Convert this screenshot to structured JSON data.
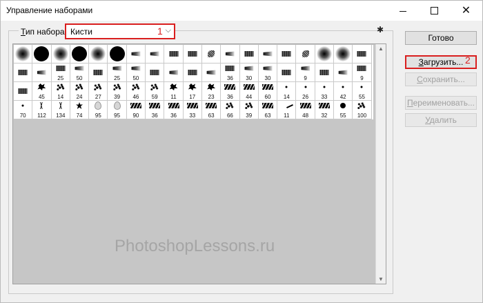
{
  "window": {
    "title": "Управление наборами",
    "controls": [
      "minimize-icon",
      "maximize-icon",
      "close-icon"
    ]
  },
  "set_type": {
    "label_prefix": "",
    "label_underline": "Т",
    "label_rest": "ип набора:",
    "value": "Кисти",
    "annotation": "1"
  },
  "presets": [
    {
      "icon": "soft",
      "size": ""
    },
    {
      "icon": "hard",
      "size": ""
    },
    {
      "icon": "soft",
      "size": ""
    },
    {
      "icon": "hard",
      "size": ""
    },
    {
      "icon": "soft",
      "size": ""
    },
    {
      "icon": "hard",
      "size": ""
    },
    {
      "icon": "bristle",
      "size": ""
    },
    {
      "icon": "bristle",
      "size": ""
    },
    {
      "icon": "flat",
      "size": ""
    },
    {
      "icon": "flat",
      "size": ""
    },
    {
      "icon": "fan",
      "size": ""
    },
    {
      "icon": "bristle",
      "size": ""
    },
    {
      "icon": "flat",
      "size": ""
    },
    {
      "icon": "bristle",
      "size": ""
    },
    {
      "icon": "flat",
      "size": ""
    },
    {
      "icon": "fan",
      "size": ""
    },
    {
      "icon": "soft",
      "size": ""
    },
    {
      "icon": "soft",
      "size": ""
    },
    {
      "icon": "flat",
      "size": ""
    },
    {
      "icon": "flat",
      "size": ""
    },
    {
      "icon": "bristle",
      "size": ""
    },
    {
      "icon": "flat",
      "size": "25"
    },
    {
      "icon": "bristle",
      "size": "50"
    },
    {
      "icon": "flat",
      "size": ""
    },
    {
      "icon": "bristle",
      "size": "25"
    },
    {
      "icon": "bristle",
      "size": "50"
    },
    {
      "icon": "flat",
      "size": ""
    },
    {
      "icon": "bristle",
      "size": ""
    },
    {
      "icon": "flat",
      "size": ""
    },
    {
      "icon": "bristle",
      "size": ""
    },
    {
      "icon": "flat",
      "size": "36"
    },
    {
      "icon": "bristle",
      "size": "30"
    },
    {
      "icon": "bristle",
      "size": "30"
    },
    {
      "icon": "flat",
      "size": ""
    },
    {
      "icon": "bristle",
      "size": "9"
    },
    {
      "icon": "flat",
      "size": ""
    },
    {
      "icon": "bristle",
      "size": ""
    },
    {
      "icon": "flat",
      "size": "9"
    },
    {
      "icon": "flat",
      "size": ""
    },
    {
      "icon": "splat",
      "size": "45"
    },
    {
      "icon": "scatter",
      "size": "14"
    },
    {
      "icon": "scatter",
      "size": "24"
    },
    {
      "icon": "scatter",
      "size": "27"
    },
    {
      "icon": "scatter",
      "size": "39"
    },
    {
      "icon": "scatter",
      "size": "46"
    },
    {
      "icon": "scatter",
      "size": "59"
    },
    {
      "icon": "splat",
      "size": "11"
    },
    {
      "icon": "splat",
      "size": "17"
    },
    {
      "icon": "splat",
      "size": "23"
    },
    {
      "icon": "texture",
      "size": "36"
    },
    {
      "icon": "texture",
      "size": "44"
    },
    {
      "icon": "texture",
      "size": "60"
    },
    {
      "icon": "dotsmall",
      "size": "14"
    },
    {
      "icon": "dotsmall",
      "size": "26"
    },
    {
      "icon": "dotsmall",
      "size": "33"
    },
    {
      "icon": "dotsmall",
      "size": "42"
    },
    {
      "icon": "dotsmall",
      "size": "55"
    },
    {
      "icon": "dotsmall",
      "size": "70"
    },
    {
      "icon": "grass",
      "size": "112"
    },
    {
      "icon": "grass",
      "size": "134"
    },
    {
      "icon": "leaf",
      "size": "74"
    },
    {
      "icon": "drop",
      "size": "95"
    },
    {
      "icon": "drop",
      "size": "95"
    },
    {
      "icon": "texture",
      "size": "90"
    },
    {
      "icon": "texture",
      "size": "36"
    },
    {
      "icon": "texture",
      "size": "36"
    },
    {
      "icon": "texture",
      "size": "33"
    },
    {
      "icon": "texture",
      "size": "63"
    },
    {
      "icon": "scatter",
      "size": "66"
    },
    {
      "icon": "scatter",
      "size": "39"
    },
    {
      "icon": "texture",
      "size": "63"
    },
    {
      "icon": "stroke",
      "size": "11"
    },
    {
      "icon": "texture",
      "size": "48"
    },
    {
      "icon": "texture",
      "size": "32"
    },
    {
      "icon": "dot",
      "size": "55"
    },
    {
      "icon": "scatter",
      "size": "100"
    }
  ],
  "buttons": {
    "done": "Готово",
    "load_u": "З",
    "load_rest": "агрузить...",
    "load_annotation": "2",
    "save_u": "С",
    "save_rest": "охранить...",
    "rename_u": "П",
    "rename_rest": "ереименовать...",
    "delete_u": "У",
    "delete_rest": "далить"
  },
  "watermark": "PhotoshopLessons.ru"
}
